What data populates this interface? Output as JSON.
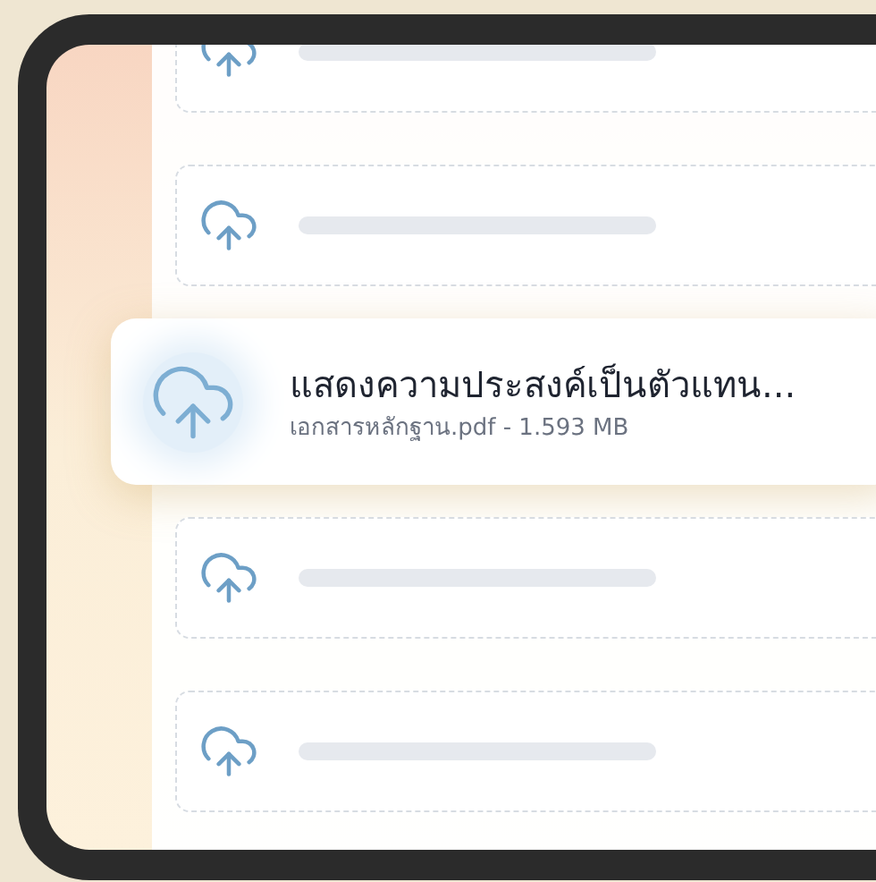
{
  "slots": [
    {
      "kind": "empty"
    },
    {
      "kind": "empty"
    },
    {
      "kind": "file",
      "title": "แสดงความประสงค์เป็นตัวแทน...",
      "subtitle": "เอกสารหลักฐาน.pdf - 1.593 MB"
    },
    {
      "kind": "empty"
    },
    {
      "kind": "empty"
    }
  ]
}
